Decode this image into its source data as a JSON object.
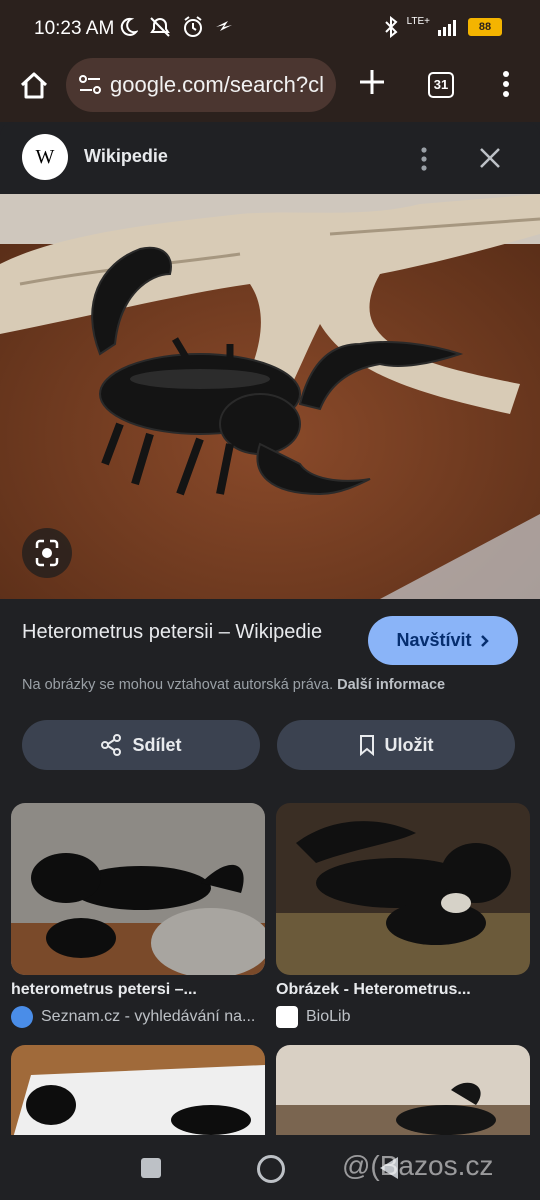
{
  "status_bar": {
    "time": "10:23 AM",
    "network": "LTE+",
    "battery": "88",
    "icons": [
      "moon-icon",
      "mute-icon",
      "alarm-icon",
      "data-saver-icon",
      "bluetooth-icon",
      "signal-icon",
      "battery-icon"
    ]
  },
  "browser": {
    "url": "google.com/search?cl",
    "tab_count": "31",
    "icons": [
      "home-icon",
      "site-settings-icon",
      "plus-icon",
      "tabs-icon",
      "more-vert-icon"
    ]
  },
  "panel": {
    "site_logo_letter": "W",
    "site_name": "Wikipedie",
    "title": "Heterometrus petersii – Wikipedie",
    "visit_label": "Navštívit",
    "copyright_text": "Na obrázky se mohou vztahovat autorská práva.",
    "more_info_label": "Další informace",
    "share_label": "Sdílet",
    "save_label": "Uložit"
  },
  "related": [
    {
      "caption": "heterometrus petersi –...",
      "source": "Seznam.cz - vyhledávání na..."
    },
    {
      "caption": "Obrázek - Heterometrus...",
      "source": "BioLib"
    }
  ],
  "watermark": "@(Bazos.cz",
  "colors": {
    "accent": "#8ab4f8",
    "toolbar": "#2b211d",
    "urlbar": "#4b3630",
    "button_bg": "#3b4250",
    "background": "#202124"
  }
}
